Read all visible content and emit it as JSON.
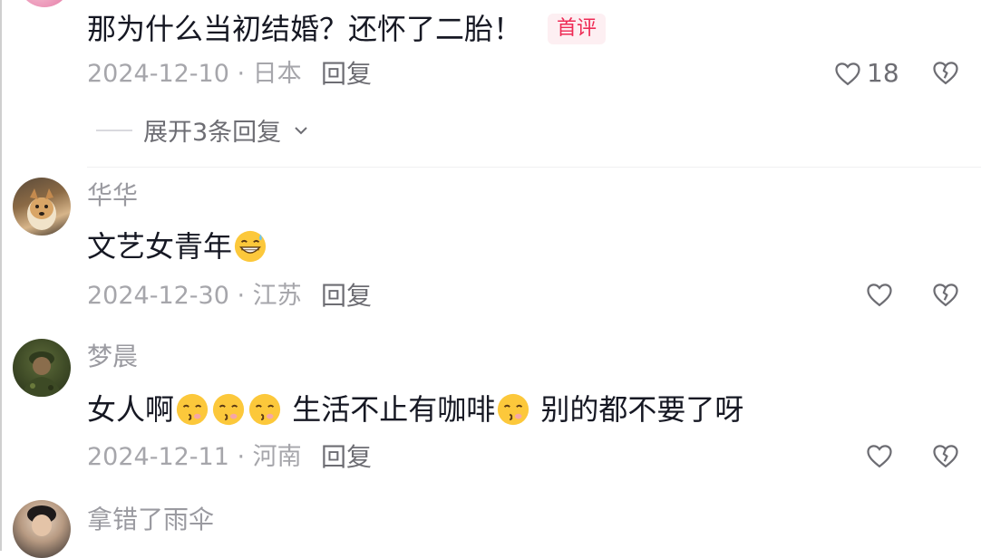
{
  "comments": [
    {
      "username": "",
      "text": "那为什么当初结婚？还怀了二胎！",
      "badge": "首评",
      "date": "2024-12-10",
      "location": "日本",
      "reply_label": "回复",
      "likes": "18",
      "expand_label": "展开3条回复"
    },
    {
      "username": "华华",
      "text": "文艺女青年",
      "emoji": "grinning-sweat-emoji",
      "date": "2024-12-30",
      "location": "江苏",
      "reply_label": "回复",
      "likes": ""
    },
    {
      "username": "梦晨",
      "text_part1": "女人啊",
      "text_part2": " 生活不止有咖啡",
      "text_part3": " 别的都不要了呀",
      "emoji": "kissing-face-emoji",
      "date": "2024-12-11",
      "location": "河南",
      "reply_label": "回复",
      "likes": ""
    },
    {
      "username": "拿错了雨伞"
    }
  ],
  "separator": " · ",
  "icons": {
    "like": "heart-outline-icon",
    "dislike": "broken-heart-icon",
    "expand": "chevron-down-icon"
  },
  "colors": {
    "badge_text": "#ee2b55",
    "badge_bg": "#fdeff2",
    "meta_text": "#a6a6ab"
  }
}
